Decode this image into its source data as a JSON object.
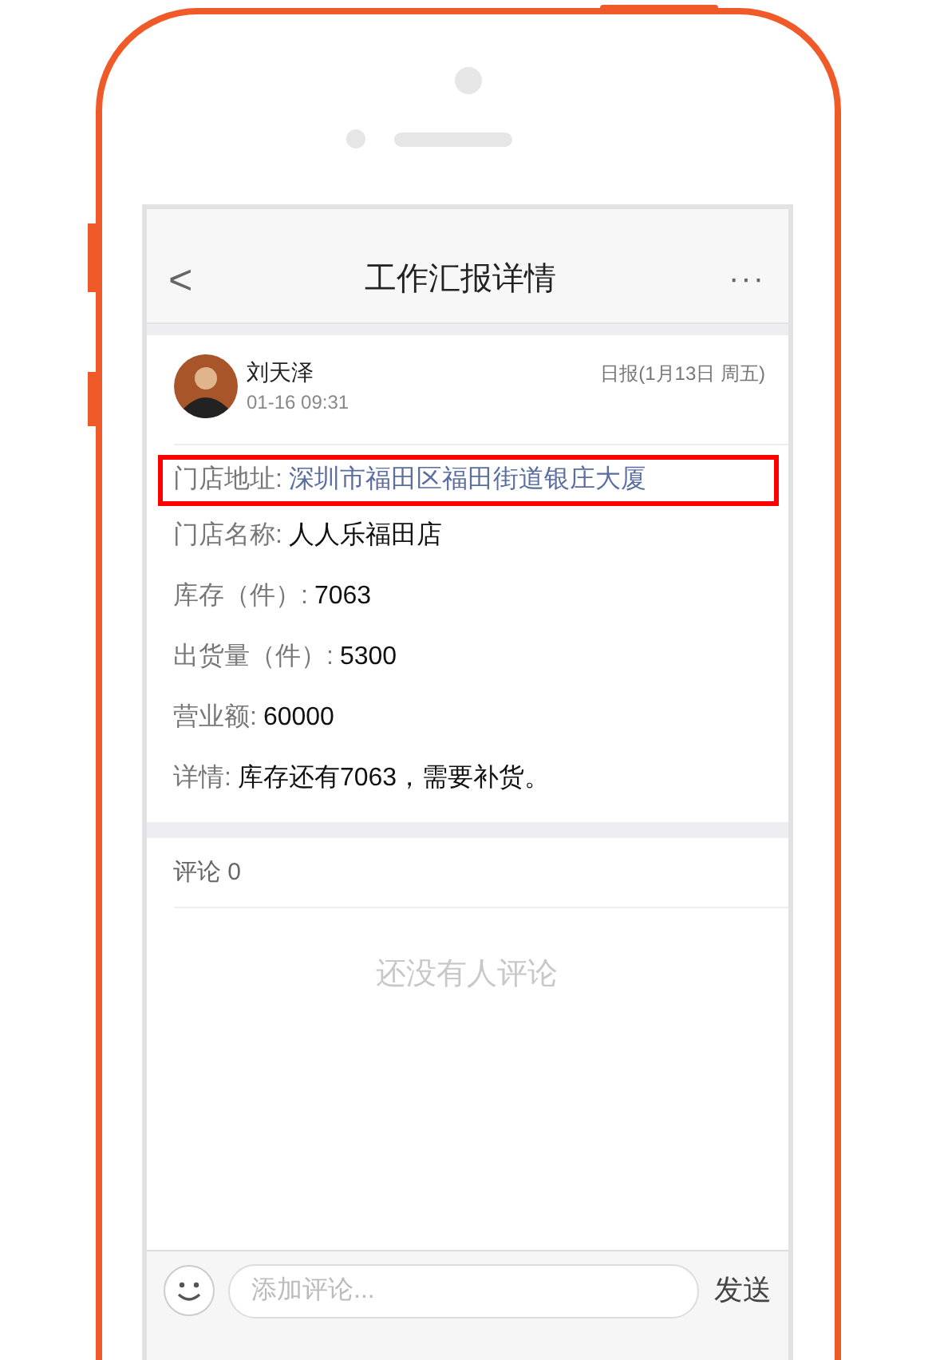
{
  "header": {
    "back": "<",
    "title": "工作汇报详情",
    "more": "···"
  },
  "report": {
    "author": "刘天泽",
    "time": "01-16 09:31",
    "type": "日报(1月13日 周五)",
    "fields": [
      {
        "label": "门店地址:",
        "value": "深圳市福田区福田街道银庄大厦",
        "kind": "link",
        "highlighted": true
      },
      {
        "label": "门店名称:",
        "value": "人人乐福田店",
        "kind": "text",
        "highlighted": false
      },
      {
        "label": "库存（件）:",
        "value": "7063",
        "kind": "text",
        "highlighted": false
      },
      {
        "label": "出货量（件）:",
        "value": "5300",
        "kind": "text",
        "highlighted": false
      },
      {
        "label": "营业额:",
        "value": "60000",
        "kind": "text",
        "highlighted": false
      },
      {
        "label": "详情:",
        "value": "库存还有7063，需要补货。",
        "kind": "text",
        "highlighted": false
      }
    ]
  },
  "comments": {
    "heading": "评论 0",
    "empty": "还没有人评论"
  },
  "composer": {
    "placeholder": "添加评论...",
    "send": "发送"
  }
}
